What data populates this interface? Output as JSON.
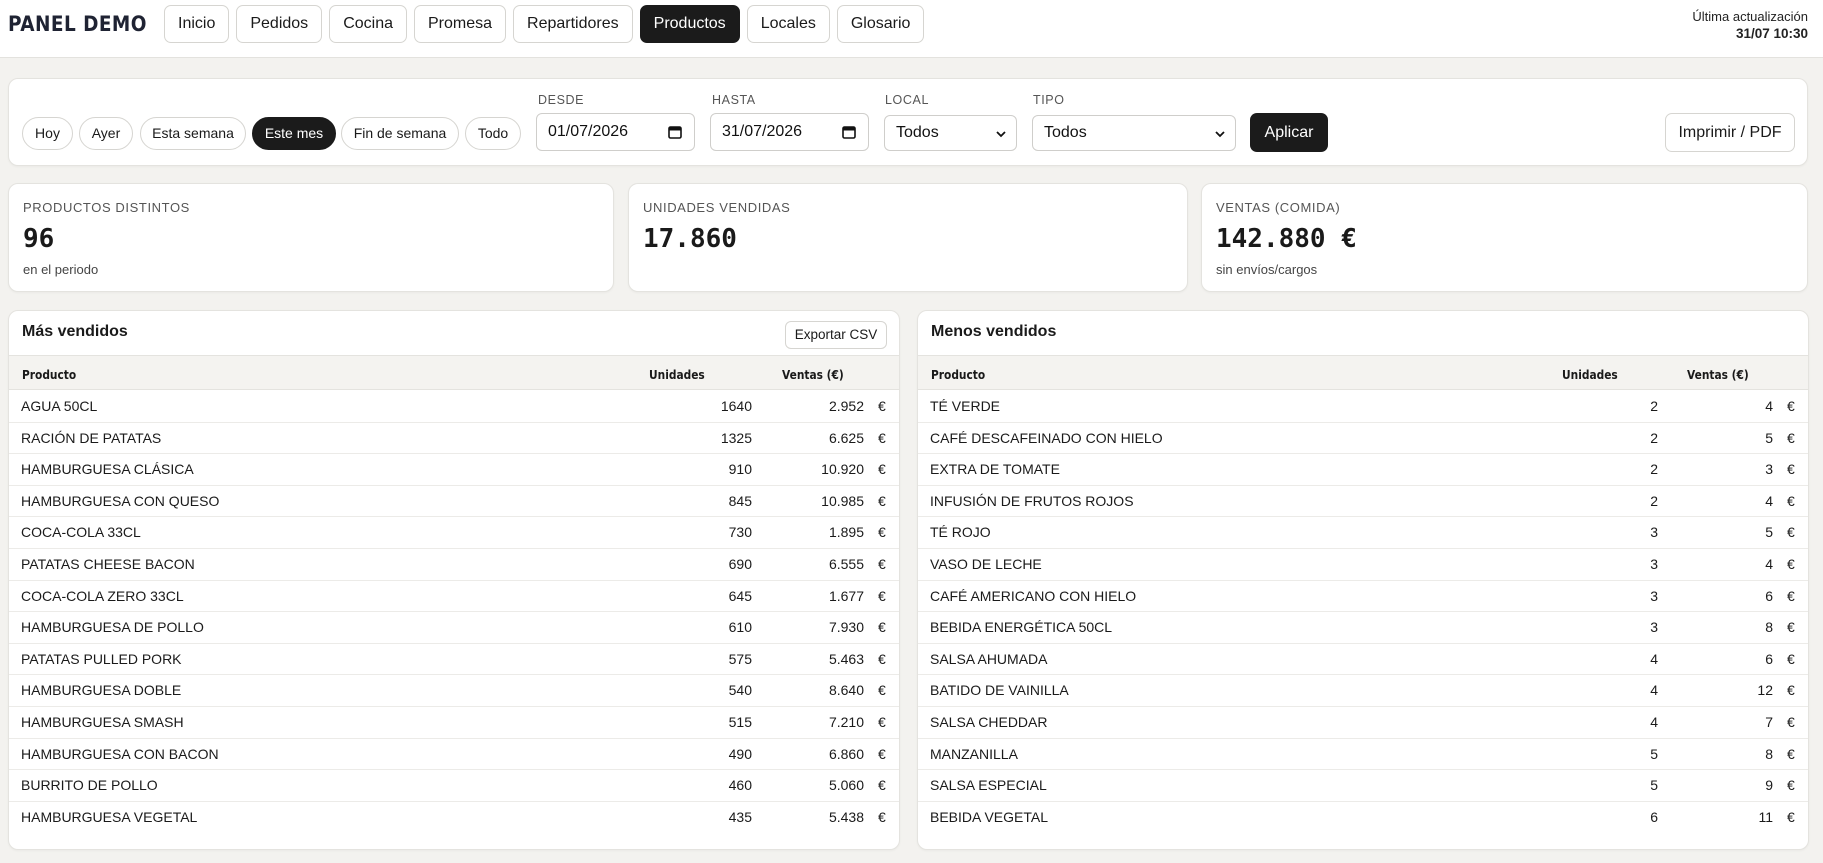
{
  "brand": "PANEL DEMO",
  "nav": [
    "Inicio",
    "Pedidos",
    "Cocina",
    "Promesa",
    "Repartidores",
    "Productos",
    "Locales",
    "Glosario"
  ],
  "nav_active": "Productos",
  "update": {
    "label": "Última actualización",
    "timestamp": "31/07 10:30"
  },
  "filters": {
    "ranges": [
      "Hoy",
      "Ayer",
      "Esta semana",
      "Este mes",
      "Fin de semana",
      "Todo"
    ],
    "range_active": "Este mes",
    "desde_label": "DESDE",
    "desde_value": "01/07/2026",
    "hasta_label": "HASTA",
    "hasta_value": "31/07/2026",
    "local_label": "LOCAL",
    "local_value": "Todos",
    "tipo_label": "TIPO",
    "tipo_value": "Todos",
    "apply": "Aplicar",
    "print": "Imprimir / PDF"
  },
  "kpis": [
    {
      "label": "PRODUCTOS DISTINTOS",
      "value": "96",
      "sub": "en el periodo"
    },
    {
      "label": "UNIDADES VENDIDAS",
      "value": "17.860",
      "sub": ""
    },
    {
      "label": "VENTAS (COMIDA)",
      "value": "142.880 €",
      "sub": "sin envíos/cargos"
    }
  ],
  "top_table": {
    "title": "Más vendidos",
    "export": "Exportar CSV",
    "columns": [
      "Producto",
      "Unidades",
      "Ventas (€)"
    ],
    "rows": [
      [
        "AGUA 50CL",
        "1640",
        "2.952"
      ],
      [
        "RACIÓN DE PATATAS",
        "1325",
        "6.625"
      ],
      [
        "HAMBURGUESA CLÁSICA",
        "910",
        "10.920"
      ],
      [
        "HAMBURGUESA CON QUESO",
        "845",
        "10.985"
      ],
      [
        "COCA-COLA 33CL",
        "730",
        "1.895"
      ],
      [
        "PATATAS CHEESE BACON",
        "690",
        "6.555"
      ],
      [
        "COCA-COLA ZERO 33CL",
        "645",
        "1.677"
      ],
      [
        "HAMBURGUESA DE POLLO",
        "610",
        "7.930"
      ],
      [
        "PATATAS PULLED PORK",
        "575",
        "5.463"
      ],
      [
        "HAMBURGUESA DOBLE",
        "540",
        "8.640"
      ],
      [
        "HAMBURGUESA SMASH",
        "515",
        "7.210"
      ],
      [
        "HAMBURGUESA CON BACON",
        "490",
        "6.860"
      ],
      [
        "BURRITO DE POLLO",
        "460",
        "5.060"
      ],
      [
        "HAMBURGUESA VEGETAL",
        "435",
        "5.438"
      ]
    ]
  },
  "bottom_table": {
    "title": "Menos vendidos",
    "columns": [
      "Producto",
      "Unidades",
      "Ventas (€)"
    ],
    "rows": [
      [
        "TÉ VERDE",
        "2",
        "4"
      ],
      [
        "CAFÉ DESCAFEINADO CON HIELO",
        "2",
        "5"
      ],
      [
        "EXTRA DE TOMATE",
        "2",
        "3"
      ],
      [
        "INFUSIÓN DE FRUTOS ROJOS",
        "2",
        "4"
      ],
      [
        "TÉ ROJO",
        "3",
        "5"
      ],
      [
        "VASO DE LECHE",
        "3",
        "4"
      ],
      [
        "CAFÉ AMERICANO CON HIELO",
        "3",
        "6"
      ],
      [
        "BEBIDA ENERGÉTICA 50CL",
        "3",
        "8"
      ],
      [
        "SALSA AHUMADA",
        "4",
        "6"
      ],
      [
        "BATIDO DE VAINILLA",
        "4",
        "12"
      ],
      [
        "SALSA CHEDDAR",
        "4",
        "7"
      ],
      [
        "MANZANILLA",
        "5",
        "8"
      ],
      [
        "SALSA ESPECIAL",
        "5",
        "9"
      ],
      [
        "BEBIDA VEGETAL",
        "6",
        "11"
      ]
    ]
  },
  "currency": "€"
}
